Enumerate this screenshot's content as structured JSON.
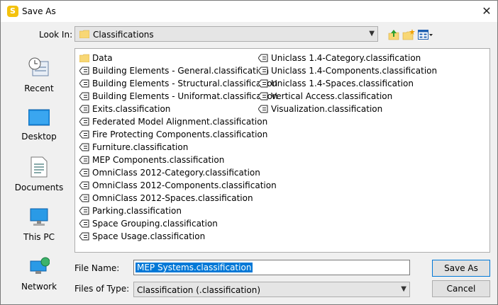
{
  "window": {
    "title": "Save As",
    "app_icon_letter": "S"
  },
  "look_in": {
    "label": "Look In:",
    "value": "Classifications"
  },
  "places": [
    "Recent",
    "Desktop",
    "Documents",
    "This PC",
    "Network"
  ],
  "files": {
    "col1": [
      {
        "name": "Data",
        "type": "folder"
      },
      {
        "name": "Building Elements - General.classification",
        "type": "file"
      },
      {
        "name": "Building Elements - Structural.classification",
        "type": "file"
      },
      {
        "name": "Building Elements - Uniformat.classification",
        "type": "file"
      },
      {
        "name": "Exits.classification",
        "type": "file"
      },
      {
        "name": "Federated Model Alignment.classification",
        "type": "file"
      },
      {
        "name": "Fire Protecting Components.classification",
        "type": "file"
      },
      {
        "name": "Furniture.classification",
        "type": "file"
      },
      {
        "name": "MEP Components.classification",
        "type": "file"
      },
      {
        "name": "OmniClass 2012-Category.classification",
        "type": "file"
      },
      {
        "name": "OmniClass 2012-Components.classification",
        "type": "file"
      },
      {
        "name": "OmniClass 2012-Spaces.classification",
        "type": "file"
      },
      {
        "name": "Parking.classification",
        "type": "file"
      },
      {
        "name": "Space Grouping.classification",
        "type": "file"
      },
      {
        "name": "Space Usage.classification",
        "type": "file"
      }
    ],
    "col2": [
      {
        "name": "Uniclass 1.4-Category.classification",
        "type": "file"
      },
      {
        "name": "Uniclass 1.4-Components.classification",
        "type": "file"
      },
      {
        "name": "Uniclass 1.4-Spaces.classification",
        "type": "file"
      },
      {
        "name": "Vertical Access.classification",
        "type": "file"
      },
      {
        "name": "Visualization.classification",
        "type": "file"
      }
    ]
  },
  "file_name": {
    "label": "File Name:",
    "value": "MEP Systems.classification"
  },
  "file_type": {
    "label": "Files of Type:",
    "value": "Classification (.classification)"
  },
  "buttons": {
    "save": "Save As",
    "cancel": "Cancel"
  },
  "colors": {
    "selection": "#0078d7",
    "folder": "#f8d775",
    "app_icon": "#f4c20d"
  }
}
